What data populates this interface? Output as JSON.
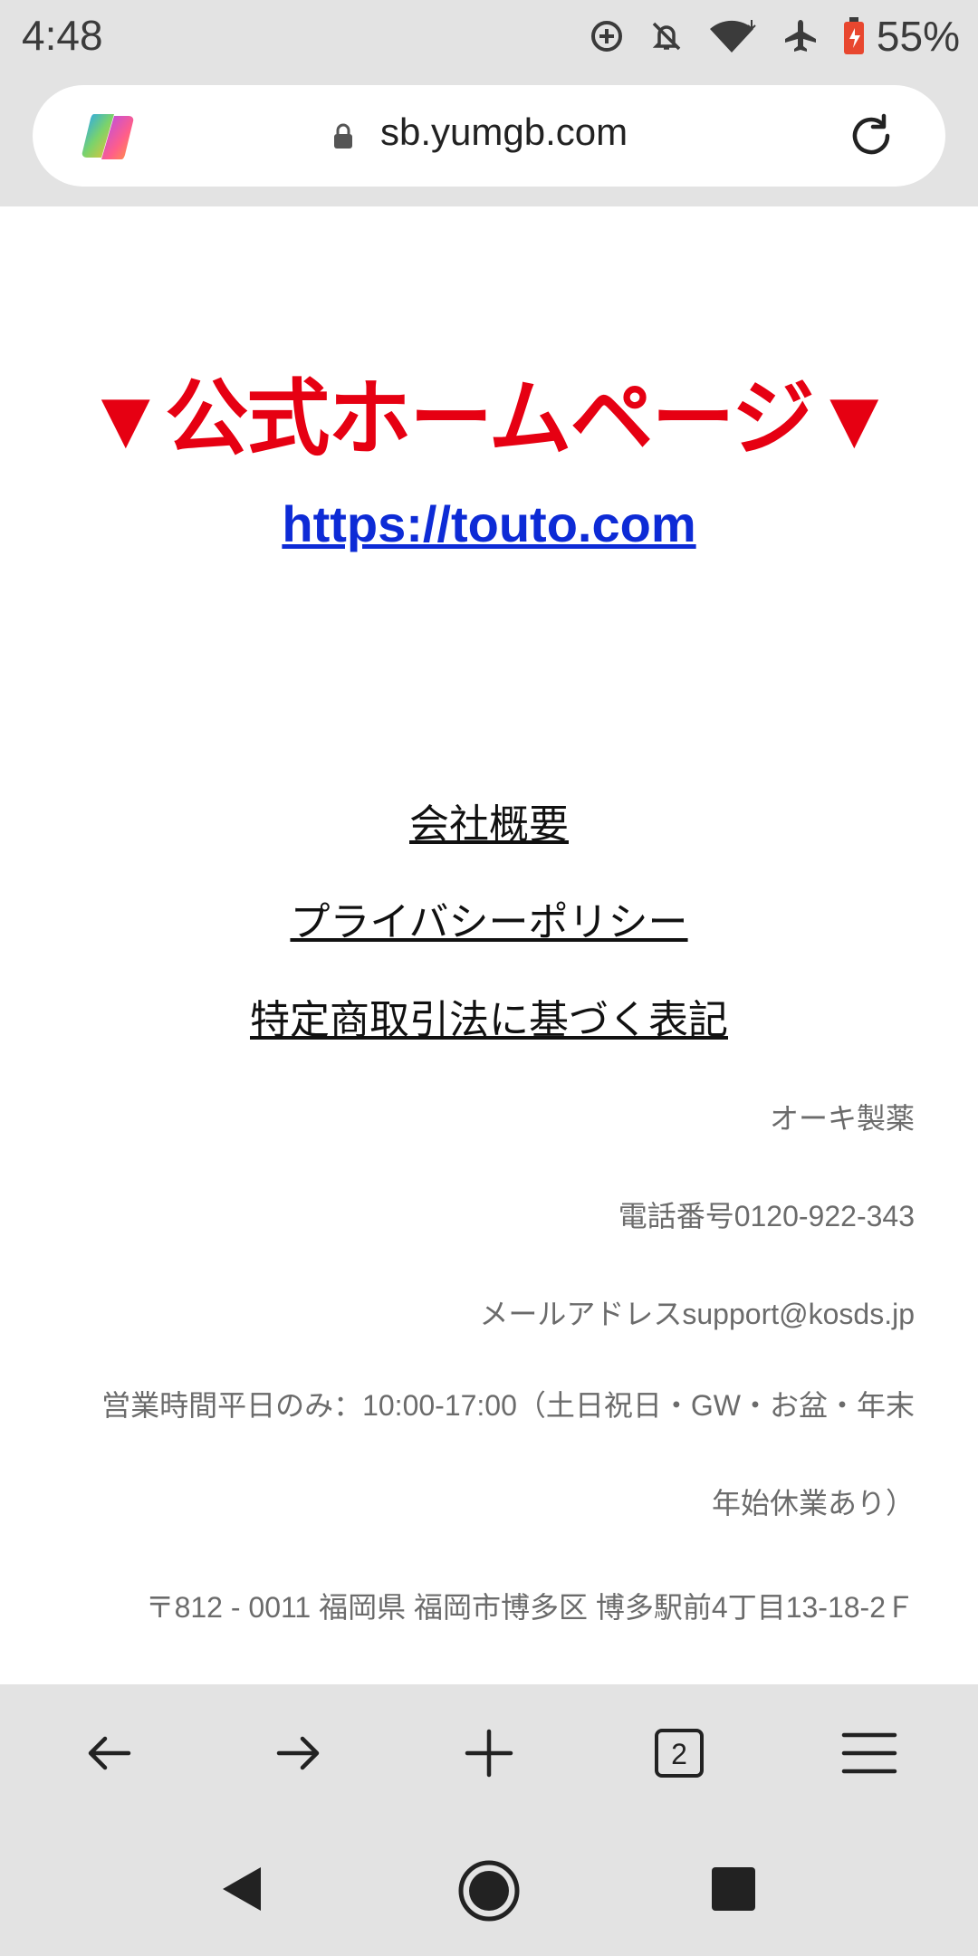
{
  "status": {
    "time": "4:48",
    "battery": "55%"
  },
  "browser": {
    "url": "sb.yumgb.com",
    "tab_count": "2"
  },
  "page": {
    "heading": "▼公式ホームページ▼",
    "official_link": "https://touto.com",
    "links": [
      "会社概要",
      "プライバシーポリシー",
      "特定商取引法に基づく表記"
    ],
    "company": "オーキ製薬",
    "phone": "電話番号0120-922-343",
    "email": "メールアドレスsupport@kosds.jp",
    "hours": "営業時間平日のみ：10:00-17:00（土日祝日・GW・お盆・年末年始休業あり）",
    "address": "〒812 - 0011 福岡県 福岡市博多区 博多駅前4丁目13-18-2Ｆ"
  },
  "colors": {
    "heading": "#e60012",
    "link": "#0d2bd6"
  }
}
